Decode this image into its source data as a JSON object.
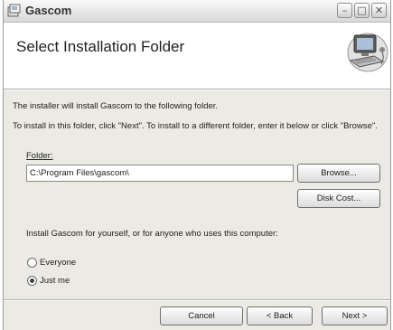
{
  "window": {
    "title": "Gascom",
    "minimize_glyph": "–",
    "maximize_glyph": "□",
    "close_glyph": "✕"
  },
  "banner": {
    "title": "Select Installation Folder",
    "image": "computer-icon"
  },
  "body": {
    "line1": "The installer will install Gascom to the following folder.",
    "line2": "To install in this folder, click \"Next\". To install to a different folder, enter it below or click \"Browse\"."
  },
  "folder": {
    "label": "Folder:",
    "value": "C:\\Program Files\\gascom\\",
    "browse_label": "Browse...",
    "disk_cost_label": "Disk Cost..."
  },
  "install_for": {
    "question": "Install Gascom for yourself, or for anyone who uses this computer:",
    "options": [
      {
        "label": "Everyone",
        "selected": false
      },
      {
        "label": "Just me",
        "selected": true
      }
    ]
  },
  "footer": {
    "cancel_label": "Cancel",
    "back_label": "< Back",
    "next_label": "Next >"
  }
}
